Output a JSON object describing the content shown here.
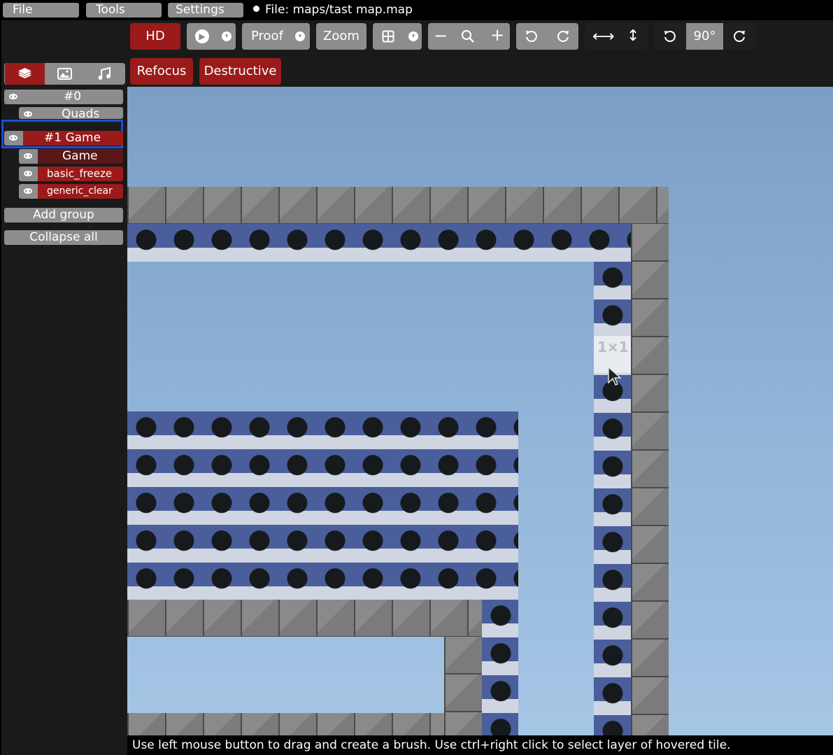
{
  "menubar": {
    "file_label": "File",
    "tools_label": "Tools",
    "settings_label": "Settings",
    "title": "File: maps/tast map.map"
  },
  "toolbar": {
    "hd_label": "HD",
    "proof_label": "Proof",
    "zoom_label": "Zoom",
    "rotation_label": "90°",
    "refocus_label": "Refocus",
    "destructive_label": "Destructive"
  },
  "sidebar": {
    "tabs": [
      "layers-icon",
      "image-icon",
      "music-icon"
    ],
    "groups": [
      {
        "label": "#0",
        "layers": [
          "Quads"
        ]
      },
      {
        "label": "#1 Game",
        "selected": true,
        "layers": [
          "Game",
          "basic_freeze",
          "generic_clear"
        ]
      }
    ],
    "add_group_label": "Add group",
    "collapse_all_label": "Collapse all"
  },
  "canvas": {
    "hover_label": "1×1"
  },
  "status_bar": {
    "text": "Use left mouse button to drag and create a brush. Use ctrl+right click to select layer of hovered tile."
  },
  "colors": {
    "accent_red": "#9b1a1a",
    "selection_blue": "#1a4fd8",
    "button_gray": "#8d8d8d"
  }
}
